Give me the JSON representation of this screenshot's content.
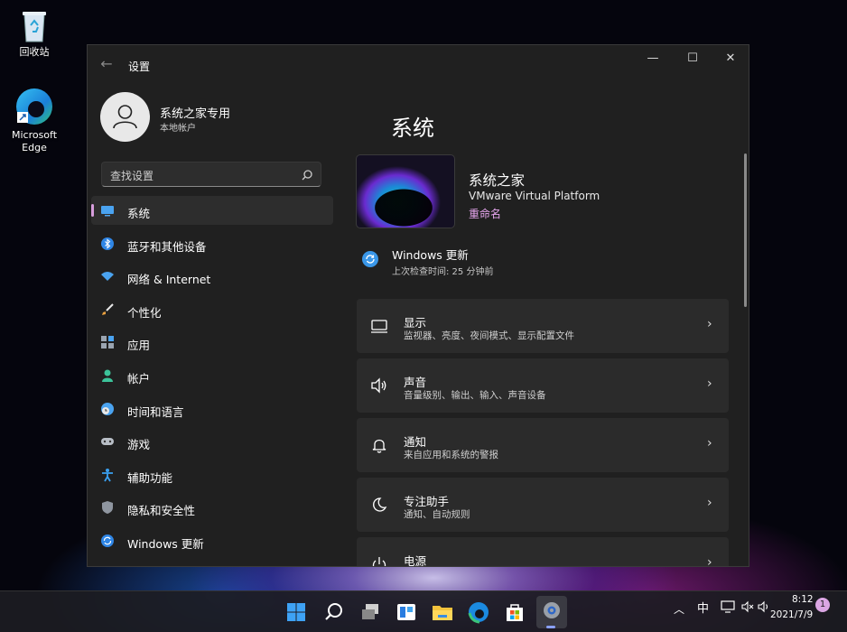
{
  "desktop": {
    "icons": [
      {
        "label": "回收站",
        "icon": "recycle-bin-icon"
      },
      {
        "label": "Microsoft Edge",
        "icon": "edge-icon"
      }
    ]
  },
  "window": {
    "title": "设置",
    "back_icon": "back-arrow-icon",
    "controls": {
      "minimize": "—",
      "maximize": "☐",
      "close": "✕"
    }
  },
  "profile": {
    "name": "系统之家专用",
    "account_type": "本地帐户",
    "avatar_icon": "user-avatar-icon"
  },
  "search": {
    "placeholder": "查找设置"
  },
  "nav": {
    "items": [
      {
        "label": "系统",
        "icon": "monitor-icon",
        "active": true
      },
      {
        "label": "蓝牙和其他设备",
        "icon": "bluetooth-icon"
      },
      {
        "label": "网络 & Internet",
        "icon": "wifi-icon"
      },
      {
        "label": "个性化",
        "icon": "brush-icon"
      },
      {
        "label": "应用",
        "icon": "apps-icon"
      },
      {
        "label": "帐户",
        "icon": "account-icon"
      },
      {
        "label": "时间和语言",
        "icon": "clock-globe-icon"
      },
      {
        "label": "游戏",
        "icon": "gamepad-icon"
      },
      {
        "label": "辅助功能",
        "icon": "accessibility-icon"
      },
      {
        "label": "隐私和安全性",
        "icon": "shield-icon"
      },
      {
        "label": "Windows 更新",
        "icon": "update-icon"
      }
    ]
  },
  "main": {
    "title": "系统",
    "device": {
      "name": "系统之家",
      "model": "VMware Virtual Platform",
      "rename": "重命名"
    },
    "windows_update": {
      "title": "Windows 更新",
      "subtitle": "上次检查时间: 25 分钟前"
    },
    "cards": [
      {
        "title": "显示",
        "subtitle": "监视器、亮度、夜间模式、显示配置文件",
        "icon": "display-icon"
      },
      {
        "title": "声音",
        "subtitle": "音量级别、输出、输入、声音设备",
        "icon": "speaker-icon"
      },
      {
        "title": "通知",
        "subtitle": "来自应用和系统的警报",
        "icon": "bell-icon"
      },
      {
        "title": "专注助手",
        "subtitle": "通知、自动规则",
        "icon": "moon-icon"
      },
      {
        "title": "电源",
        "subtitle": "",
        "icon": "power-icon"
      }
    ]
  },
  "taskbar": {
    "apps": [
      "start-icon",
      "search-icon",
      "task-view-icon",
      "widgets-icon",
      "file-explorer-icon",
      "edge-icon",
      "store-icon",
      "settings-icon"
    ],
    "tray": {
      "ime": "中",
      "time": "8:12",
      "date": "2021/7/9",
      "notifications": "1"
    }
  },
  "colors": {
    "accent": "#d79ddc",
    "window_bg": "#202020",
    "card_bg": "#2b2b2b",
    "link": "#e6a6ee"
  }
}
